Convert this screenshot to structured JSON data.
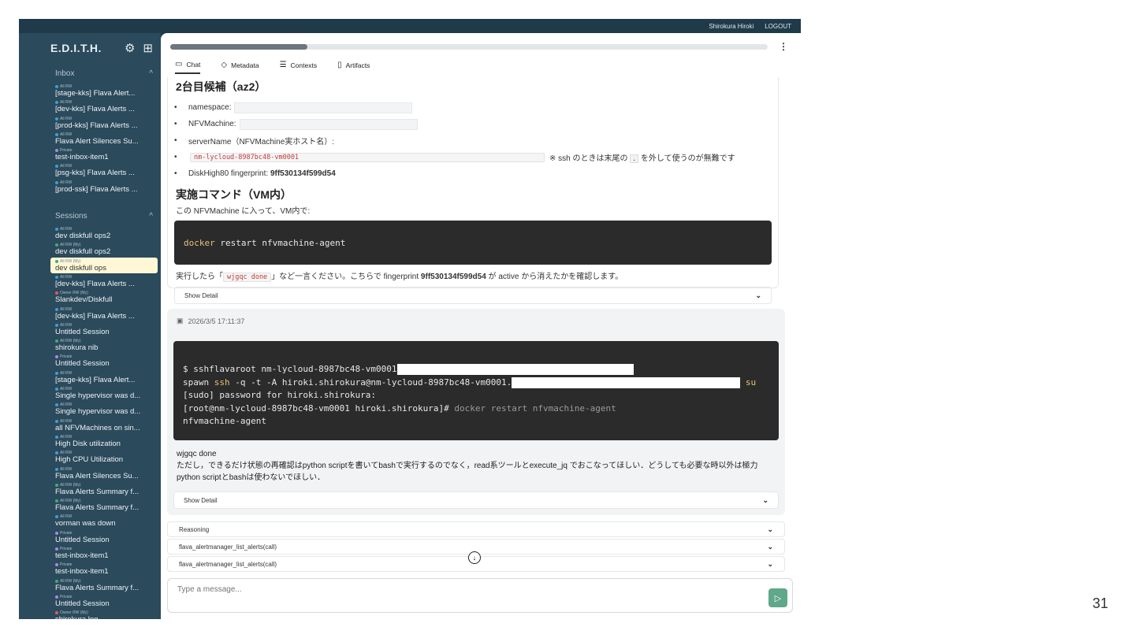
{
  "slide_number": "31",
  "topbar": {
    "user": "Shirokura Hiroki",
    "logout": "LOGOUT"
  },
  "sidebar": {
    "brand": "E.D.I.T.H.",
    "inbox_header": "Inbox",
    "inbox": [
      {
        "meta": "All RW",
        "title": "[stage-kks] Flava Alert...",
        "color": "#3aa0d8"
      },
      {
        "meta": "All RW",
        "title": "[dev-kks] Flava Alerts ...",
        "color": "#3aa0d8"
      },
      {
        "meta": "All RW",
        "title": "[prod-kks] Flava Alerts ...",
        "color": "#3aa0d8"
      },
      {
        "meta": "All RW",
        "title": "Flava Alert Silences Su...",
        "color": "#3aa0d8"
      },
      {
        "meta": "Private",
        "title": "test-inbox-item1",
        "color": "#a98be0"
      },
      {
        "meta": "All RW",
        "title": "[psg-kks] Flava Alerts ...",
        "color": "#3aa0d8"
      },
      {
        "meta": "All RW",
        "title": "[prod-ssk] Flava Alerts ...",
        "color": "#3aa0d8"
      }
    ],
    "sessions_header": "Sessions",
    "sessions": [
      {
        "meta": "All RW",
        "title": "dev diskfull ops2",
        "color": "#3aa0d8"
      },
      {
        "meta": "All RW (My)",
        "title": "dev diskfull ops2",
        "color": "#3ab07a"
      },
      {
        "meta": "All RW (My)",
        "title": "dev diskfull ops",
        "color": "#3ab07a",
        "active": true
      },
      {
        "meta": "All RW",
        "title": "[dev-kks] Flava Alerts ...",
        "color": "#3aa0d8"
      },
      {
        "meta": "Owner RW (My)",
        "title": "Slankdev/Diskfull",
        "color": "#e05a5a"
      },
      {
        "meta": "All RW",
        "title": "[dev-kks] Flava Alerts ...",
        "color": "#3aa0d8"
      },
      {
        "meta": "All RW",
        "title": "Untitled Session",
        "color": "#3aa0d8"
      },
      {
        "meta": "All RW (My)",
        "title": "shirokura nib",
        "color": "#3ab07a"
      },
      {
        "meta": "Private",
        "title": "Untitled Session",
        "color": "#a98be0"
      },
      {
        "meta": "All RW",
        "title": "[stage-kks] Flava Alert...",
        "color": "#3aa0d8"
      },
      {
        "meta": "All RW",
        "title": "Single hypervisor was d...",
        "color": "#3aa0d8"
      },
      {
        "meta": "All RW",
        "title": "Single hypervisor was d...",
        "color": "#3aa0d8"
      },
      {
        "meta": "All RW",
        "title": "all NFVMachines on sin...",
        "color": "#3aa0d8"
      },
      {
        "meta": "All RW",
        "title": "High Disk utilization",
        "color": "#3aa0d8"
      },
      {
        "meta": "All RW",
        "title": "High CPU Utilization",
        "color": "#3aa0d8"
      },
      {
        "meta": "All RW",
        "title": "Flava Alert Silences Su...",
        "color": "#3aa0d8"
      },
      {
        "meta": "All RW (My)",
        "title": "Flava Alerts Summary f...",
        "color": "#3ab07a"
      },
      {
        "meta": "All RW (My)",
        "title": "Flava Alerts Summary f...",
        "color": "#3ab07a"
      },
      {
        "meta": "All RW",
        "title": "vorman was down",
        "color": "#3aa0d8"
      },
      {
        "meta": "Private",
        "title": "Untitled Session",
        "color": "#a98be0"
      },
      {
        "meta": "Private",
        "title": "test-inbox-item1",
        "color": "#a98be0"
      },
      {
        "meta": "Private",
        "title": "test-inbox-item1",
        "color": "#a98be0"
      },
      {
        "meta": "All RW (My)",
        "title": "Flava Alerts Summary f...",
        "color": "#3ab07a"
      },
      {
        "meta": "Private",
        "title": "Untitled Session",
        "color": "#a98be0"
      },
      {
        "meta": "Owner RW (My)",
        "title": "shirokura log",
        "color": "#e05a5a"
      }
    ]
  },
  "main": {
    "progress": 0.23,
    "tabs": [
      {
        "label": "Chat",
        "icon": "chat-icon"
      },
      {
        "label": "Metadata",
        "icon": "tag-icon"
      },
      {
        "label": "Contexts",
        "icon": "database-icon"
      },
      {
        "label": "Artifacts",
        "icon": "file-icon"
      }
    ],
    "msg1": {
      "heading": "2台目候補（az2）",
      "ns_label": "namespace:",
      "nfv_label": "NFVMachine:",
      "server_label": "serverName（NFVMachine実ホスト名）:",
      "server_code": "nm-lycloud-8987bc48-vm0001",
      "server_note_pre": "※ ssh のときは末尾の",
      "server_note_kbd": ".",
      "server_note_post": "を外して使うのが無難です",
      "disk_label": "DiskHigh80 fingerprint:",
      "disk_fp": "9ff530134f599d54",
      "heading2": "実施コマンド（VM内）",
      "intro": "この NFVMachine に入って、VM内で:",
      "code_cmd": "docker",
      "code_args": " restart nfvmachine-agent",
      "after_pre": "実行したら「",
      "after_code": "wjgqc done",
      "after_mid": "」など一言ください。こちらで fingerprint ",
      "after_fp": "9ff530134f599d54",
      "after_post": " が active から消えたかを確認します。",
      "show_detail": "Show Detail"
    },
    "msg2": {
      "timestamp": "2026/3/5 17:11:37",
      "term_l1": "$ sshflavaroot nm-lycloud-8987bc48-vm0001",
      "term_l2_a": "spawn ",
      "term_l2_ssh": "ssh",
      "term_l2_b": " -q -t -A hiroki.shirokura@nm-lycloud-8987bc48-vm0001.",
      "term_l2_c": "su",
      "term_l3": "[sudo] password for hiroki.shirokura:",
      "term_l4_a": "[root@nm-lycloud-8987bc48-vm0001 hiroki.shirokura]#",
      "term_l4_b": " docker restart nfvmachine-agent",
      "term_l5": "nfvmachine-agent",
      "line1": "wjgqc done",
      "line2": "ただし，できるだけ状態の再確認はpython scriptを書いてbashで実行するのでなく，read系ツールとexecute_jq でおこなってほしい．どうしても必要な時以外は極力python scriptとbashは使わないでほしい．",
      "show_detail": "Show Detail"
    },
    "collapsibles": [
      "Reasoning",
      "flava_alertmanager_list_alerts(call)",
      "flava_alertmanager_list_alerts(call)"
    ],
    "composer_placeholder": "Type a message..."
  }
}
